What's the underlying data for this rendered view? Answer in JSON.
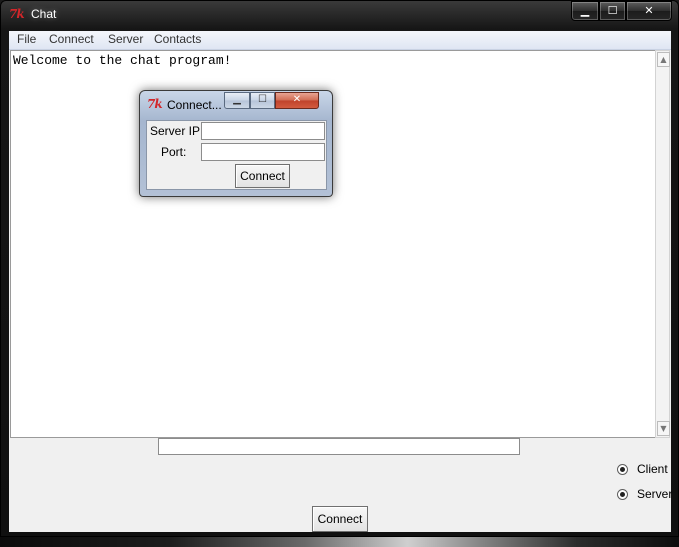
{
  "window": {
    "title": "Chat",
    "logo_text": "7k",
    "controls": {
      "minimize": "▁",
      "maximize": "☐",
      "close": "✕"
    }
  },
  "menubar": {
    "items": [
      {
        "label": "File"
      },
      {
        "label": "Connect"
      },
      {
        "label": "Server"
      },
      {
        "label": "Contacts"
      }
    ]
  },
  "chat": {
    "welcome_text": "Welcome to the chat program!"
  },
  "scrollbar": {
    "up_arrow": "▲",
    "down_arrow": "▼"
  },
  "message_input": {
    "value": "",
    "placeholder": ""
  },
  "mode": {
    "options": [
      {
        "label": "Client"
      },
      {
        "label": "Server"
      }
    ]
  },
  "main_button": {
    "label": "Connect"
  },
  "dialog": {
    "title": "Connect...",
    "logo_text": "7k",
    "controls": {
      "minimize": "▁",
      "maximize": "☐",
      "close": "✕"
    },
    "server_ip_label": "Server IP:",
    "server_ip_value": "",
    "port_label": "Port:",
    "port_value": "",
    "connect_label": "Connect"
  }
}
